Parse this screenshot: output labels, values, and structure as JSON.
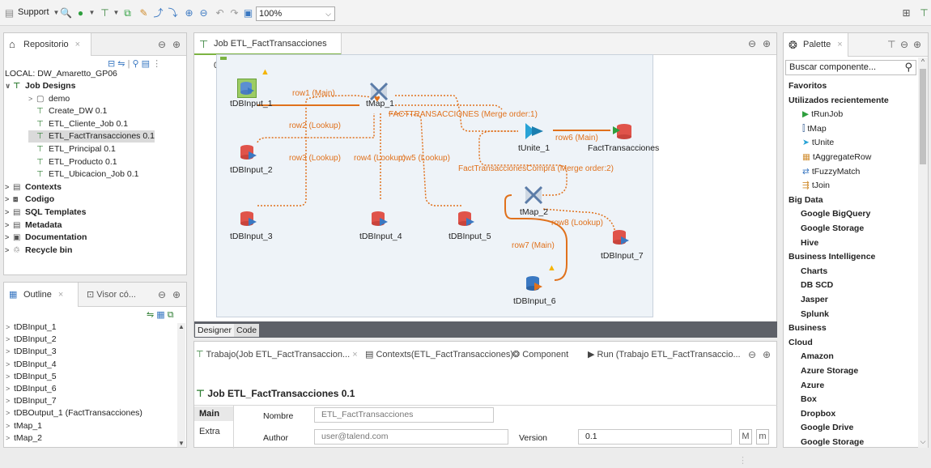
{
  "toolbar": {
    "support_label": "Support",
    "zoom_value": "100%"
  },
  "repository": {
    "tab_label": "Repositorio",
    "local_label": "LOCAL: DW_Amaretto_GP06",
    "tree": [
      {
        "label": "Job Designs",
        "level": 0,
        "bold": true,
        "expanded": true,
        "icon": "job-designs-icon"
      },
      {
        "label": "demo",
        "level": 1,
        "icon": "folder-icon"
      },
      {
        "label": "Create_DW 0.1",
        "level": 1,
        "icon": "job-icon"
      },
      {
        "label": "ETL_Cliente_Job 0.1",
        "level": 1,
        "icon": "job-icon"
      },
      {
        "label": "ETL_FactTransacciones 0.1",
        "level": 1,
        "icon": "job-icon",
        "selected": true
      },
      {
        "label": "ETL_Principal 0.1",
        "level": 1,
        "icon": "job-icon"
      },
      {
        "label": "ETL_Producto 0.1",
        "level": 1,
        "icon": "job-icon"
      },
      {
        "label": "ETL_Ubicacion_Job 0.1",
        "level": 1,
        "icon": "job-icon"
      },
      {
        "label": "Contexts",
        "level": 0,
        "bold": true,
        "icon": "contexts-icon"
      },
      {
        "label": "Codigo",
        "level": 0,
        "bold": true,
        "icon": "code-icon"
      },
      {
        "label": "SQL Templates",
        "level": 0,
        "bold": true,
        "icon": "sql-icon"
      },
      {
        "label": "Metadata",
        "level": 0,
        "bold": true,
        "icon": "metadata-icon"
      },
      {
        "label": "Documentation",
        "level": 0,
        "bold": true,
        "icon": "documentation-icon"
      },
      {
        "label": "Recycle bin",
        "level": 0,
        "bold": true,
        "icon": "recycle-bin-icon"
      }
    ]
  },
  "outline": {
    "tab_label": "Outline",
    "tab2_label": "Visor có...",
    "items": [
      "tDBInput_1",
      "tDBInput_2",
      "tDBInput_3",
      "tDBInput_4",
      "tDBInput_5",
      "tDBInput_6",
      "tDBInput_7",
      "tDBOutput_1 (FactTransacciones)",
      "tMap_1",
      "tMap_2"
    ]
  },
  "editor": {
    "tab_label": "Job ETL_FactTransacciones 0.1",
    "designer_tab": "Designer",
    "code_tab": "Code",
    "components": {
      "tDBInput_1": "tDBInput_1",
      "tDBInput_2": "tDBInput_2",
      "tDBInput_3": "tDBInput_3",
      "tDBInput_4": "tDBInput_4",
      "tDBInput_5": "tDBInput_5",
      "tDBInput_6": "tDBInput_6",
      "tDBInput_7": "tDBInput_7",
      "tMap_1": "tMap_1",
      "tMap_2": "tMap_2",
      "tUnite_1": "tUnite_1",
      "FactTransacciones": "FactTransacciones"
    },
    "flows": {
      "row1": "row1 (Main)",
      "row2": "row2 (Lookup)",
      "row3": "row3 (Lookup)",
      "row4": "row4 (Lookup)",
      "row5": "row5 (Lookup)",
      "row6": "row6 (Main)",
      "row7": "row7 (Main)",
      "row8": "row8 (Lookup)",
      "fact1": "FACTTRANSACCIONES (Merge order:1)",
      "fact2": "FactTransaccionesCompra (Merge order:2)"
    }
  },
  "bottom": {
    "tab1": "Trabajo(Job ETL_FactTransaccion...",
    "tab2": "Contexts(ETL_FactTransacciones)",
    "tab3": "Component",
    "tab4": "Run (Trabajo ETL_FactTransaccio...",
    "title": "Job ETL_FactTransacciones 0.1",
    "side_main": "Main",
    "side_extra": "Extra",
    "nombre_label": "Nombre",
    "nombre_value": "ETL_FactTransacciones",
    "author_label": "Author",
    "author_value": "user@talend.com",
    "version_label": "Version",
    "version_value": "0.1",
    "m_upper": "M",
    "m_lower": "m"
  },
  "palette": {
    "tab_label": "Palette",
    "search_placeholder": "Buscar componente...",
    "items": [
      {
        "label": "Favoritos",
        "kind": "cat"
      },
      {
        "label": "Utilizados recientemente",
        "kind": "cat"
      },
      {
        "label": "tRunJob",
        "kind": "comp",
        "icon": "run-job-icon"
      },
      {
        "label": "tMap",
        "kind": "comp",
        "icon": "map-icon"
      },
      {
        "label": "tUnite",
        "kind": "comp",
        "icon": "unite-icon"
      },
      {
        "label": "tAggregateRow",
        "kind": "comp",
        "icon": "aggregate-icon"
      },
      {
        "label": "tFuzzyMatch",
        "kind": "comp",
        "icon": "fuzzy-match-icon"
      },
      {
        "label": "tJoin",
        "kind": "comp",
        "icon": "join-icon"
      },
      {
        "label": "Big Data",
        "kind": "cat"
      },
      {
        "label": "Google BigQuery",
        "kind": "sub"
      },
      {
        "label": "Google Storage",
        "kind": "sub"
      },
      {
        "label": "Hive",
        "kind": "sub"
      },
      {
        "label": "Business Intelligence",
        "kind": "cat"
      },
      {
        "label": "Charts",
        "kind": "sub"
      },
      {
        "label": "DB SCD",
        "kind": "sub"
      },
      {
        "label": "Jasper",
        "kind": "sub"
      },
      {
        "label": "Splunk",
        "kind": "sub"
      },
      {
        "label": "Business",
        "kind": "cat"
      },
      {
        "label": "Cloud",
        "kind": "cat"
      },
      {
        "label": "Amazon",
        "kind": "sub"
      },
      {
        "label": "Azure Storage",
        "kind": "sub"
      },
      {
        "label": "Azure",
        "kind": "sub"
      },
      {
        "label": "Box",
        "kind": "sub"
      },
      {
        "label": "Dropbox",
        "kind": "sub"
      },
      {
        "label": "Google Drive",
        "kind": "sub"
      },
      {
        "label": "Google Storage",
        "kind": "sub"
      }
    ]
  },
  "colors": {
    "flow_orange": "#e0711c",
    "db_red": "#e0534a",
    "accent_green": "#2e7d32"
  }
}
